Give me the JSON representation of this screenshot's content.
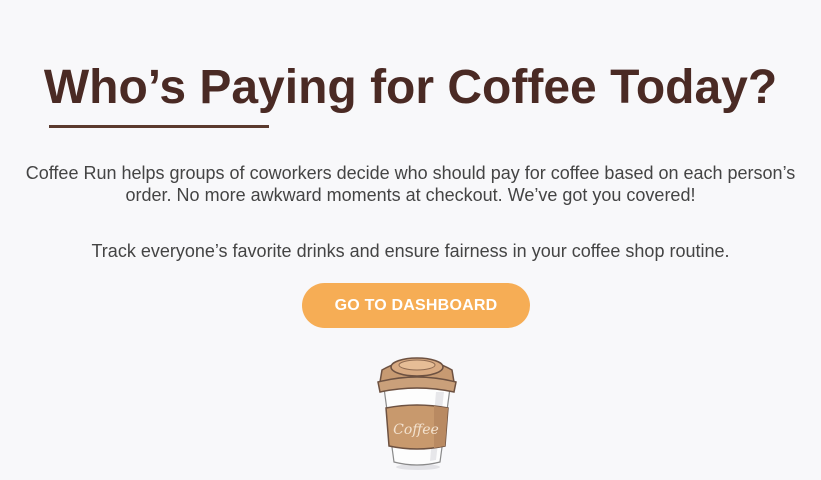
{
  "hero": {
    "title": "Who’s Paying for Coffee Today?",
    "description": "Coffee Run helps groups of coworkers decide who should pay for coffee based on each person’s order. No more awkward moments at checkout. We’ve got you covered!",
    "tagline": "Track everyone’s favorite drinks and ensure fairness in your coffee shop routine.",
    "cta_label": "GO TO DASHBOARD",
    "cup_label": "Coffee"
  },
  "colors": {
    "title": "#4a2a24",
    "accent_button": "#f6ad55",
    "background": "#f8f8fa",
    "body_text": "#444444"
  },
  "icons": {
    "illustration": "coffee-cup-icon"
  }
}
